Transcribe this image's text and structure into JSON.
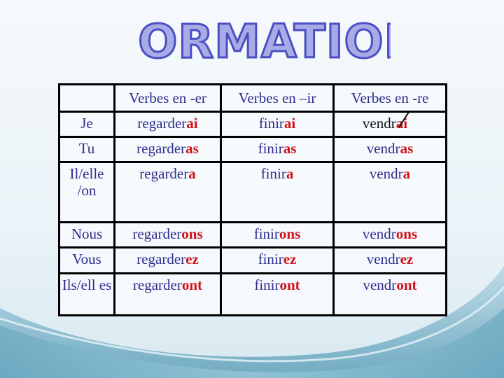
{
  "title": "FORMATION",
  "colors": {
    "title_fill": "#a9abe6",
    "title_stroke": "#4a4fc4",
    "stem_text": "#2e2e8c",
    "ending_text": "#d0121a",
    "border": "#000000"
  },
  "table": {
    "headers": [
      "",
      "Verbes en -er",
      "Verbes en –ir",
      "Verbes en -re"
    ],
    "rows": [
      {
        "pronoun": "Je",
        "er": {
          "stem": "regarder",
          "ending": "ai"
        },
        "ir": {
          "stem": "finir",
          "ending": "ai"
        },
        "re": {
          "stem": "vendr",
          "ending": "ai",
          "note": "slash-mark over r"
        }
      },
      {
        "pronoun": "Tu",
        "er": {
          "stem": "regarder",
          "ending": "as"
        },
        "ir": {
          "stem": "finir",
          "ending": "as"
        },
        "re": {
          "stem": "vendr",
          "ending": "as"
        }
      },
      {
        "pronoun": "Il/elle /on",
        "er": {
          "stem": "regarder",
          "ending": "a"
        },
        "ir": {
          "stem": "finir",
          "ending": "a"
        },
        "re": {
          "stem": "vendr",
          "ending": "a"
        }
      },
      {
        "pronoun": "Nous",
        "er": {
          "stem": "regarder",
          "ending": "ons"
        },
        "ir": {
          "stem": "finir",
          "ending": "ons"
        },
        "re": {
          "stem": "vendr",
          "ending": "ons"
        }
      },
      {
        "pronoun": "Vous",
        "er": {
          "stem": "regarder",
          "ending": "ez"
        },
        "ir": {
          "stem": "finir",
          "ending": "ez"
        },
        "re": {
          "stem": "vendr",
          "ending": "ez"
        }
      },
      {
        "pronoun": "Ils/ell es",
        "er": {
          "stem": "regarder",
          "ending": "ont"
        },
        "ir": {
          "stem": "finir",
          "ending": "ont"
        },
        "re": {
          "stem": "vendr",
          "ending": "ont"
        }
      }
    ]
  }
}
